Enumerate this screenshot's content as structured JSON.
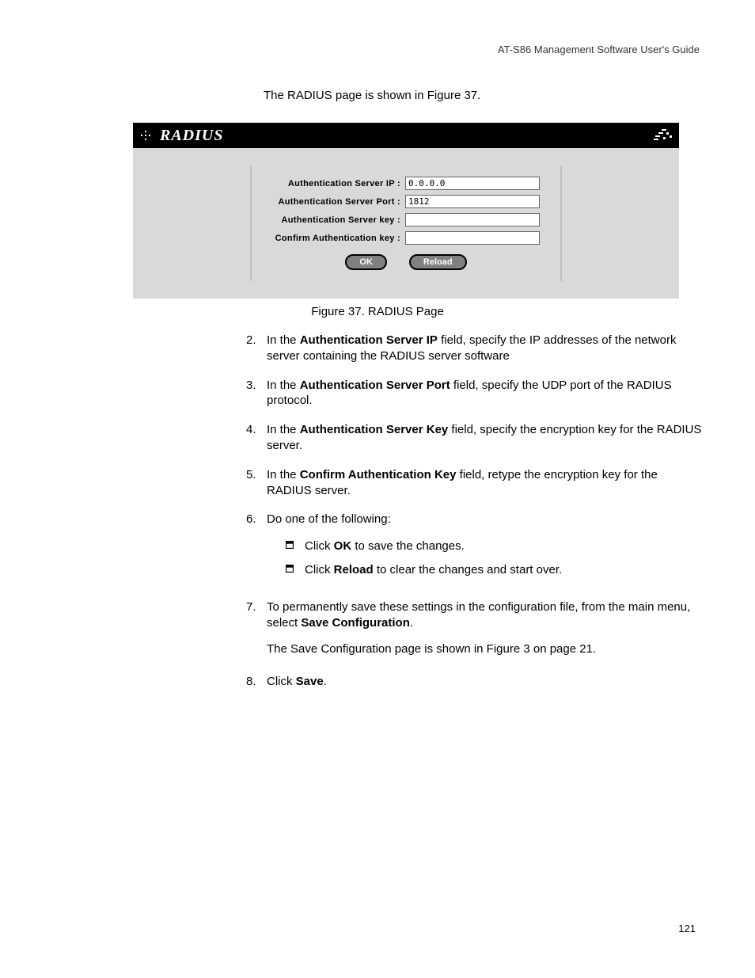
{
  "header_right": "AT-S86 Management Software User's Guide",
  "intro": "The RADIUS page is shown in Figure 37.",
  "screenshot": {
    "title": "RADIUS",
    "fields": {
      "ip_label": "Authentication Server IP :",
      "ip_value": "0.0.0.0",
      "port_label": "Authentication Server Port :",
      "port_value": "1812",
      "key_label": "Authentication Server key :",
      "key_value": "",
      "confirm_label": "Confirm Authentication key :",
      "confirm_value": ""
    },
    "buttons": {
      "ok": "OK",
      "reload": "Reload"
    }
  },
  "figure_caption": "Figure 37. RADIUS Page",
  "steps": {
    "s2": {
      "num": "2.",
      "pre": "In the ",
      "bold": "Authentication Server IP",
      "post": " field, specify the IP addresses of the network server containing the RADIUS server software"
    },
    "s3": {
      "num": "3.",
      "pre": "In the ",
      "bold": "Authentication Server Port",
      "post": " field, specify the UDP port of the RADIUS protocol."
    },
    "s4": {
      "num": "4.",
      "pre": "In the ",
      "bold": "Authentication Server Key",
      "post": " field, specify the encryption key for the RADIUS server."
    },
    "s5": {
      "num": "5.",
      "pre": "In the ",
      "bold": "Confirm Authentication Key",
      "post": " field, retype the encryption key for the RADIUS server."
    },
    "s6": {
      "num": "6.",
      "text": "Do one of the following:",
      "sub1": {
        "pre": "Click ",
        "bold": "OK",
        "post": " to save the changes."
      },
      "sub2": {
        "pre": "Click ",
        "bold": "Reload",
        "post": " to clear the changes and start over."
      }
    },
    "s7": {
      "num": "7.",
      "pre": "To permanently save these settings in the configuration file, from the main menu, select ",
      "bold": "Save Configuration",
      "post": ".",
      "extra": "The Save Configuration page is shown in Figure 3 on page 21."
    },
    "s8": {
      "num": "8.",
      "pre": "Click ",
      "bold": "Save",
      "post": "."
    }
  },
  "page_number": "121"
}
